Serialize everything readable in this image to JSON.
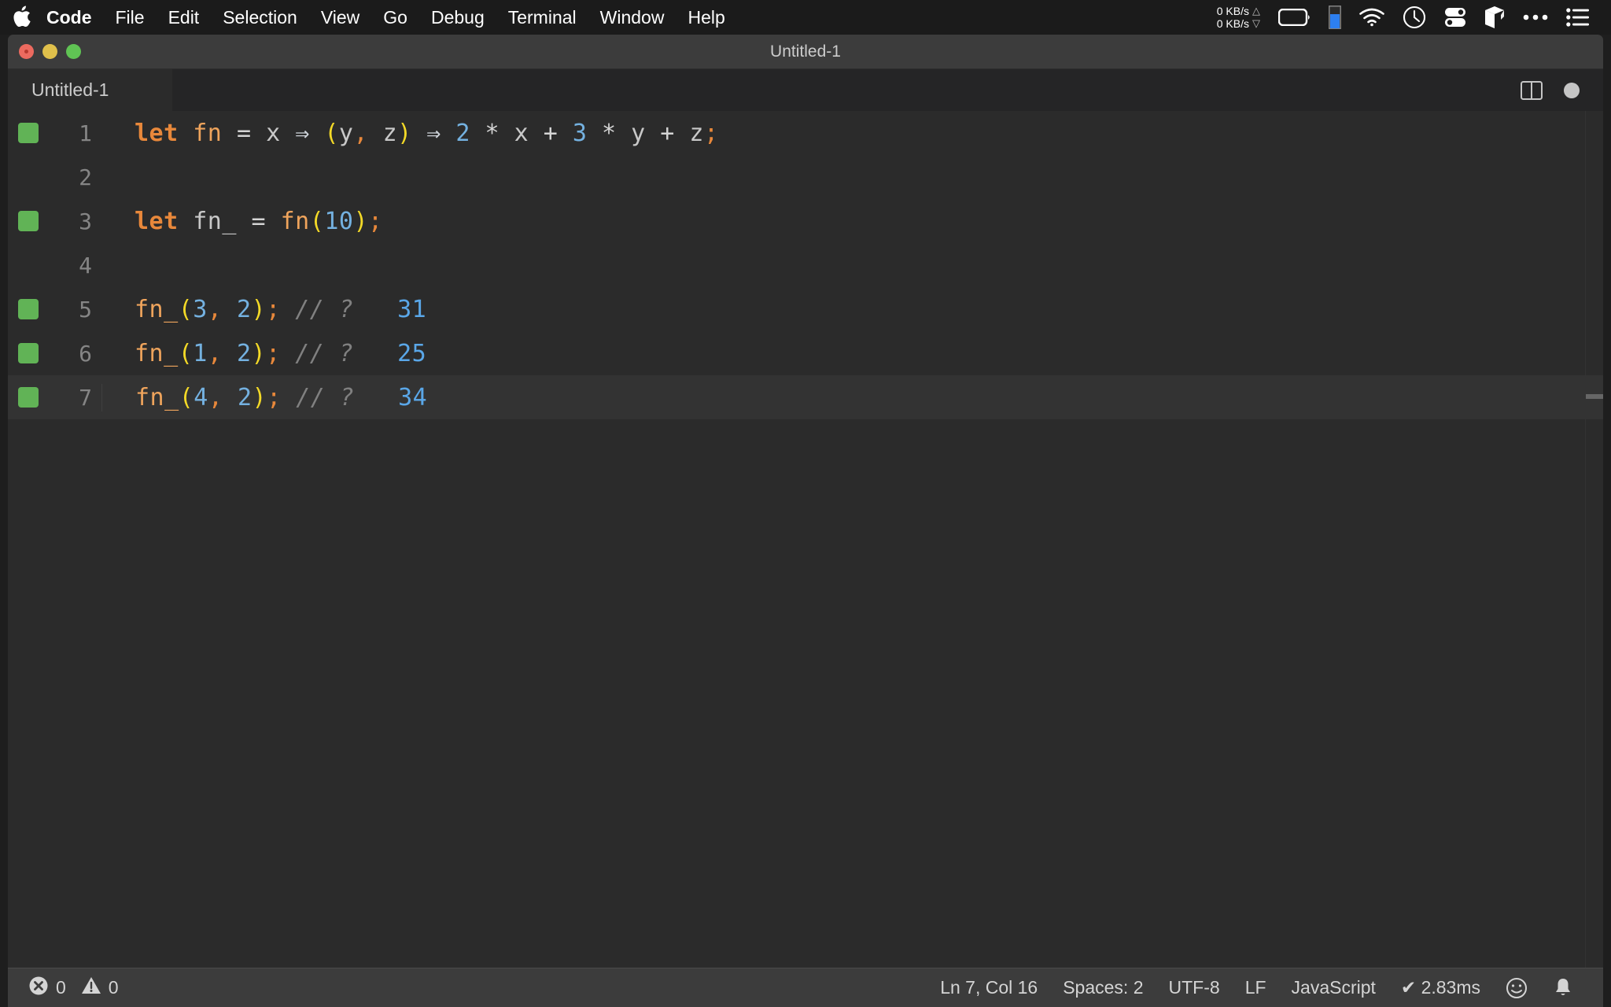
{
  "menubar": {
    "apple_icon": "apple-logo-icon",
    "items": [
      {
        "label": "Code",
        "bold": true
      },
      {
        "label": "File",
        "bold": false
      },
      {
        "label": "Edit",
        "bold": false
      },
      {
        "label": "Selection",
        "bold": false
      },
      {
        "label": "View",
        "bold": false
      },
      {
        "label": "Go",
        "bold": false
      },
      {
        "label": "Debug",
        "bold": false
      },
      {
        "label": "Terminal",
        "bold": false
      },
      {
        "label": "Window",
        "bold": false
      },
      {
        "label": "Help",
        "bold": false
      }
    ],
    "tray": {
      "net_up": "0 KB/s",
      "net_down": "0 KB/s",
      "icons": [
        "battery-icon",
        "blue-bar-indicator-icon",
        "wifi-icon",
        "clock-icon",
        "toggles-icon",
        "cube-icon",
        "ellipsis-icon",
        "list-menu-icon"
      ]
    }
  },
  "window": {
    "title": "Untitled-1",
    "traffic_lights": [
      "close-button",
      "minimize-button",
      "maximize-button"
    ]
  },
  "tabs": [
    {
      "label": "Untitled-1",
      "active": true
    }
  ],
  "tab_actions": {
    "split_editor": "split-editor-icon",
    "dirty_indicator": "unsaved-dot-icon"
  },
  "editor": {
    "lines": [
      {
        "number": "1",
        "marker": true,
        "active": false,
        "tokens": [
          {
            "t": "let",
            "c": "tk-keyword"
          },
          {
            "t": " ",
            "c": "tk-op"
          },
          {
            "t": "fn",
            "c": "tk-func"
          },
          {
            "t": " ",
            "c": "tk-op"
          },
          {
            "t": "=",
            "c": "tk-op"
          },
          {
            "t": " ",
            "c": "tk-op"
          },
          {
            "t": "x",
            "c": "tk-var"
          },
          {
            "t": " ",
            "c": "tk-op"
          },
          {
            "t": "⇒",
            "c": "tk-arrow"
          },
          {
            "t": " ",
            "c": "tk-op"
          },
          {
            "t": "(",
            "c": "tk-paren"
          },
          {
            "t": "y",
            "c": "tk-var"
          },
          {
            "t": ",",
            "c": "tk-punct"
          },
          {
            "t": " ",
            "c": "tk-op"
          },
          {
            "t": "z",
            "c": "tk-var"
          },
          {
            "t": ")",
            "c": "tk-paren"
          },
          {
            "t": " ",
            "c": "tk-op"
          },
          {
            "t": "⇒",
            "c": "tk-arrow"
          },
          {
            "t": " ",
            "c": "tk-op"
          },
          {
            "t": "2",
            "c": "tk-number"
          },
          {
            "t": " ",
            "c": "tk-op"
          },
          {
            "t": "*",
            "c": "tk-op"
          },
          {
            "t": " ",
            "c": "tk-op"
          },
          {
            "t": "x",
            "c": "tk-var"
          },
          {
            "t": " ",
            "c": "tk-op"
          },
          {
            "t": "+",
            "c": "tk-op"
          },
          {
            "t": " ",
            "c": "tk-op"
          },
          {
            "t": "3",
            "c": "tk-number"
          },
          {
            "t": " ",
            "c": "tk-op"
          },
          {
            "t": "*",
            "c": "tk-op"
          },
          {
            "t": " ",
            "c": "tk-op"
          },
          {
            "t": "y",
            "c": "tk-var"
          },
          {
            "t": " ",
            "c": "tk-op"
          },
          {
            "t": "+",
            "c": "tk-op"
          },
          {
            "t": " ",
            "c": "tk-op"
          },
          {
            "t": "z",
            "c": "tk-var"
          },
          {
            "t": ";",
            "c": "tk-punct"
          }
        ],
        "plain": "let fn = x ⇒ (y, z) ⇒ 2 * x + 3 * y + z;"
      },
      {
        "number": "2",
        "marker": false,
        "active": false,
        "tokens": [],
        "plain": ""
      },
      {
        "number": "3",
        "marker": true,
        "active": false,
        "tokens": [
          {
            "t": "let",
            "c": "tk-keyword"
          },
          {
            "t": " ",
            "c": "tk-op"
          },
          {
            "t": "fn_",
            "c": "tk-var"
          },
          {
            "t": " ",
            "c": "tk-op"
          },
          {
            "t": "=",
            "c": "tk-op"
          },
          {
            "t": " ",
            "c": "tk-op"
          },
          {
            "t": "fn",
            "c": "tk-func"
          },
          {
            "t": "(",
            "c": "tk-paren"
          },
          {
            "t": "10",
            "c": "tk-number"
          },
          {
            "t": ")",
            "c": "tk-paren"
          },
          {
            "t": ";",
            "c": "tk-punct"
          }
        ],
        "plain": "let fn_ = fn(10);"
      },
      {
        "number": "4",
        "marker": false,
        "active": false,
        "tokens": [],
        "plain": ""
      },
      {
        "number": "5",
        "marker": true,
        "active": false,
        "tokens": [
          {
            "t": "fn_",
            "c": "tk-func"
          },
          {
            "t": "(",
            "c": "tk-paren"
          },
          {
            "t": "3",
            "c": "tk-number"
          },
          {
            "t": ",",
            "c": "tk-punct"
          },
          {
            "t": " ",
            "c": "tk-op"
          },
          {
            "t": "2",
            "c": "tk-number"
          },
          {
            "t": ")",
            "c": "tk-paren"
          },
          {
            "t": ";",
            "c": "tk-punct"
          },
          {
            "t": " ",
            "c": "tk-op"
          },
          {
            "t": "// ?",
            "c": "tk-comment"
          },
          {
            "t": "   ",
            "c": "tk-op"
          },
          {
            "t": "31",
            "c": "tk-inline"
          }
        ],
        "plain": "fn_(3, 2); // ?   31"
      },
      {
        "number": "6",
        "marker": true,
        "active": false,
        "tokens": [
          {
            "t": "fn_",
            "c": "tk-func"
          },
          {
            "t": "(",
            "c": "tk-paren"
          },
          {
            "t": "1",
            "c": "tk-number"
          },
          {
            "t": ",",
            "c": "tk-punct"
          },
          {
            "t": " ",
            "c": "tk-op"
          },
          {
            "t": "2",
            "c": "tk-number"
          },
          {
            "t": ")",
            "c": "tk-paren"
          },
          {
            "t": ";",
            "c": "tk-punct"
          },
          {
            "t": " ",
            "c": "tk-op"
          },
          {
            "t": "// ?",
            "c": "tk-comment"
          },
          {
            "t": "   ",
            "c": "tk-op"
          },
          {
            "t": "25",
            "c": "tk-inline"
          }
        ],
        "plain": "fn_(1, 2); // ?   25"
      },
      {
        "number": "7",
        "marker": true,
        "active": true,
        "tokens": [
          {
            "t": "fn_",
            "c": "tk-func"
          },
          {
            "t": "(",
            "c": "tk-paren"
          },
          {
            "t": "4",
            "c": "tk-number"
          },
          {
            "t": ",",
            "c": "tk-punct"
          },
          {
            "t": " ",
            "c": "tk-op"
          },
          {
            "t": "2",
            "c": "tk-number"
          },
          {
            "t": ")",
            "c": "tk-paren"
          },
          {
            "t": ";",
            "c": "tk-punct"
          },
          {
            "t": " ",
            "c": "tk-op"
          },
          {
            "t": "// ?",
            "c": "tk-comment"
          },
          {
            "t": "   ",
            "c": "tk-op"
          },
          {
            "t": "34",
            "c": "tk-inline"
          }
        ],
        "plain": "fn_(4, 2); // ?   34"
      }
    ]
  },
  "statusbar": {
    "errors": "0",
    "warnings": "0",
    "cursor_position": "Ln 7, Col 16",
    "indentation": "Spaces: 2",
    "encoding": "UTF-8",
    "eol": "LF",
    "language": "JavaScript",
    "run_time": "✔ 2.83ms",
    "feedback_icon": "smiley-icon",
    "notifications_icon": "bell-icon"
  },
  "colors": {
    "menubar_bg": "#1b1b1b",
    "titlebar_bg": "#3c3c3c",
    "editor_bg": "#2b2b2b",
    "statusbar_bg": "#3c3c3c",
    "quokka_green": "#61b356",
    "keyword_orange": "#e8883b",
    "number_blue": "#74b1e0",
    "paren_yellow": "#f3d927",
    "inline_value_blue": "#5aa7e8"
  }
}
